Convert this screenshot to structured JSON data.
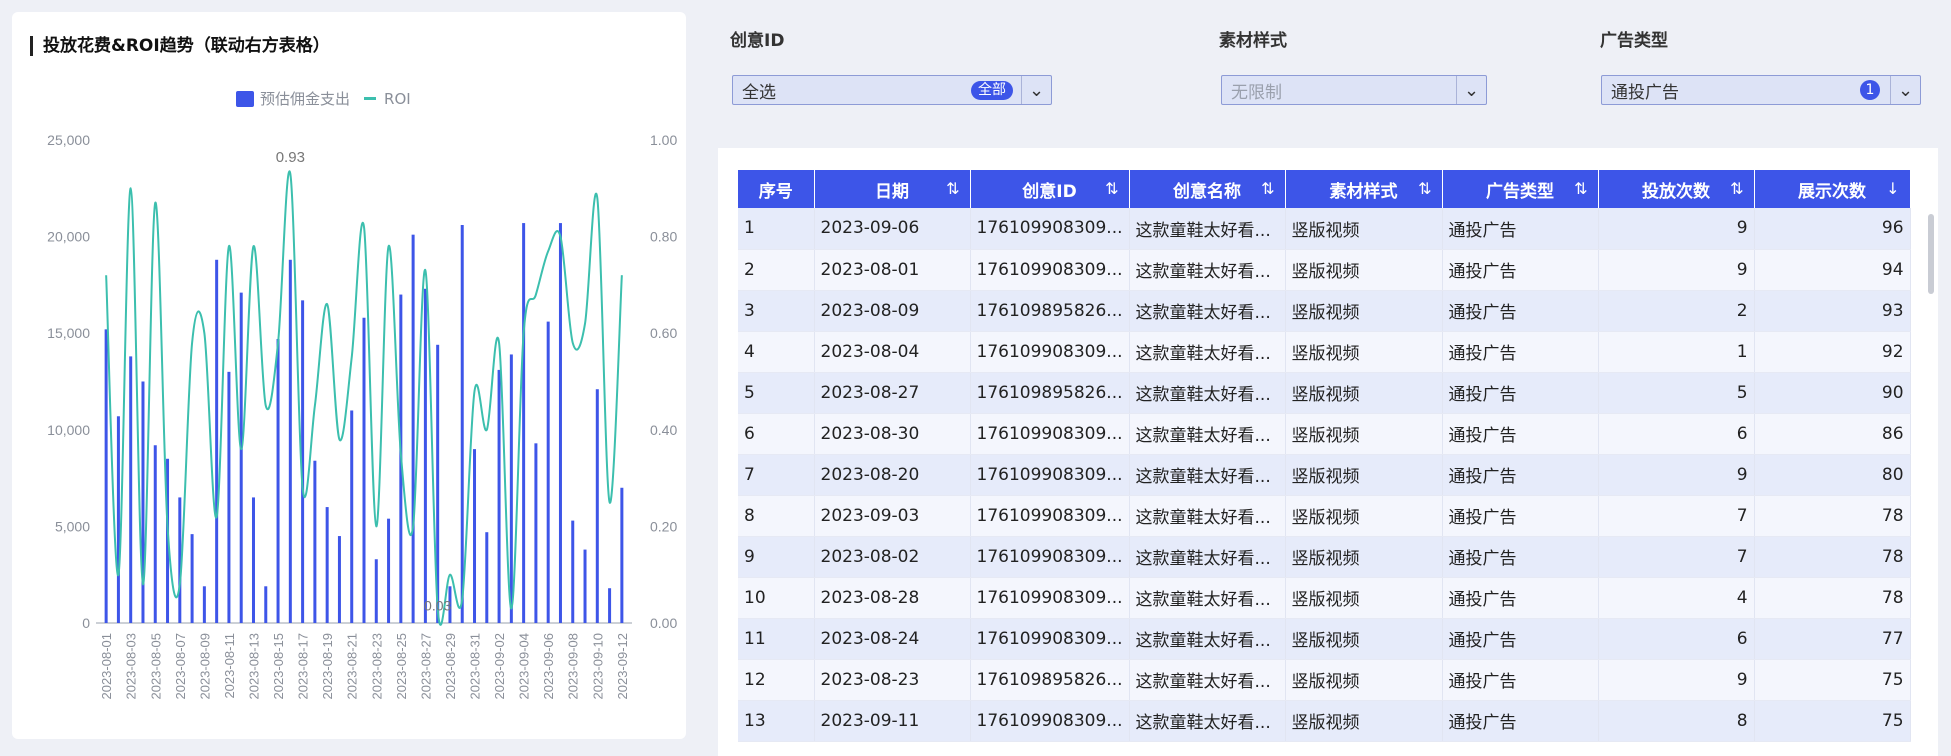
{
  "chart": {
    "title": "投放花费&ROI趋势（联动右方表格）",
    "legend": [
      {
        "name": "预估佣金支出",
        "kind": "bar",
        "color": "#3d55e8"
      },
      {
        "name": "ROI",
        "kind": "line",
        "color": "#3cbfae"
      }
    ],
    "annotations": {
      "max_label": "0.93",
      "min_label": "0.03"
    }
  },
  "chart_data": {
    "type": "bar",
    "x": [
      "2023-08-01",
      "2023-08-02",
      "2023-08-03",
      "2023-08-04",
      "2023-08-05",
      "2023-08-06",
      "2023-08-07",
      "2023-08-08",
      "2023-08-09",
      "2023-08-10",
      "2023-08-11",
      "2023-08-12",
      "2023-08-13",
      "2023-08-14",
      "2023-08-15",
      "2023-08-16",
      "2023-08-17",
      "2023-08-18",
      "2023-08-19",
      "2023-08-20",
      "2023-08-21",
      "2023-08-22",
      "2023-08-23",
      "2023-08-24",
      "2023-08-25",
      "2023-08-26",
      "2023-08-27",
      "2023-08-28",
      "2023-08-29",
      "2023-08-30",
      "2023-08-31",
      "2023-09-01",
      "2023-09-02",
      "2023-09-03",
      "2023-09-04",
      "2023-09-05",
      "2023-09-06",
      "2023-09-07",
      "2023-09-08",
      "2023-09-09",
      "2023-09-10",
      "2023-09-11",
      "2023-09-12"
    ],
    "xticks": [
      "2023-08-01",
      "2023-08-03",
      "2023-08-05",
      "2023-08-07",
      "2023-08-09",
      "2023-08-11",
      "2023-08-13",
      "2023-08-15",
      "2023-08-17",
      "2023-08-19",
      "2023-08-21",
      "2023-08-23",
      "2023-08-25",
      "2023-08-27",
      "2023-08-29",
      "2023-08-31",
      "2023-09-02",
      "2023-09-04",
      "2023-09-06",
      "2023-09-08",
      "2023-09-10",
      "2023-09-12"
    ],
    "series": [
      {
        "name": "预估佣金支出",
        "axis": "left",
        "type": "bar",
        "values": [
          15200,
          10700,
          13800,
          12500,
          9200,
          8500,
          6500,
          4600,
          1900,
          18800,
          13000,
          17100,
          6500,
          1900,
          14700,
          18800,
          16700,
          8400,
          6000,
          4500,
          11000,
          15800,
          3300,
          5400,
          17000,
          20100,
          17300,
          14400,
          1900,
          20600,
          9000,
          4700,
          13100,
          13900,
          20700,
          9300,
          15600,
          20700,
          5300,
          3800,
          12100,
          1800,
          7000
        ]
      },
      {
        "name": "ROI",
        "axis": "right",
        "type": "line",
        "values": [
          0.72,
          0.1,
          0.9,
          0.08,
          0.87,
          0.2,
          0.08,
          0.58,
          0.6,
          0.22,
          0.78,
          0.36,
          0.78,
          0.45,
          0.58,
          0.93,
          0.28,
          0.45,
          0.66,
          0.38,
          0.55,
          0.82,
          0.2,
          0.78,
          0.35,
          0.2,
          0.73,
          0.03,
          0.1,
          0.05,
          0.48,
          0.4,
          0.58,
          0.03,
          0.6,
          0.68,
          0.77,
          0.8,
          0.58,
          0.62,
          0.88,
          0.25,
          0.72
        ]
      }
    ],
    "ylim_left": [
      0,
      25000
    ],
    "yticks_left": [
      "0",
      "5,000",
      "10,000",
      "15,000",
      "20,000",
      "25,000"
    ],
    "ylim_right": [
      0,
      1
    ],
    "yticks_right": [
      "0.00",
      "0.20",
      "0.40",
      "0.60",
      "0.80",
      "1.00"
    ],
    "legend_position": "top-center",
    "grid": false
  },
  "filters": [
    {
      "label": "创意ID",
      "value": "全选",
      "badge": "全部",
      "disabled": false
    },
    {
      "label": "素材样式",
      "value": "无限制",
      "badge": "",
      "disabled": true
    },
    {
      "label": "广告类型",
      "value": "通投广告",
      "badge": "1",
      "disabled": false
    }
  ],
  "table": {
    "columns": [
      "序号",
      "日期",
      "创意ID",
      "创意名称",
      "素材样式",
      "广告类型",
      "投放次数",
      "展示次数"
    ],
    "sort_icons": [
      "",
      "⇅",
      "⇅",
      "⇅",
      "⇅",
      "⇅",
      "⇅",
      "↓"
    ],
    "rows": [
      [
        "1",
        "2023-09-06",
        "176109908309...",
        "这款童鞋太好看...",
        "竖版视频",
        "通投广告",
        "9",
        "96"
      ],
      [
        "2",
        "2023-08-01",
        "176109908309...",
        "这款童鞋太好看...",
        "竖版视频",
        "通投广告",
        "9",
        "94"
      ],
      [
        "3",
        "2023-08-09",
        "176109895826...",
        "这款童鞋太好看...",
        "竖版视频",
        "通投广告",
        "2",
        "93"
      ],
      [
        "4",
        "2023-08-04",
        "176109908309...",
        "这款童鞋太好看...",
        "竖版视频",
        "通投广告",
        "1",
        "92"
      ],
      [
        "5",
        "2023-08-27",
        "176109895826...",
        "这款童鞋太好看...",
        "竖版视频",
        "通投广告",
        "5",
        "90"
      ],
      [
        "6",
        "2023-08-30",
        "176109908309...",
        "这款童鞋太好看...",
        "竖版视频",
        "通投广告",
        "6",
        "86"
      ],
      [
        "7",
        "2023-08-20",
        "176109908309...",
        "这款童鞋太好看...",
        "竖版视频",
        "通投广告",
        "9",
        "80"
      ],
      [
        "8",
        "2023-09-03",
        "176109908309...",
        "这款童鞋太好看...",
        "竖版视频",
        "通投广告",
        "7",
        "78"
      ],
      [
        "9",
        "2023-08-02",
        "176109908309...",
        "这款童鞋太好看...",
        "竖版视频",
        "通投广告",
        "7",
        "78"
      ],
      [
        "10",
        "2023-08-28",
        "176109908309...",
        "这款童鞋太好看...",
        "竖版视频",
        "通投广告",
        "4",
        "78"
      ],
      [
        "11",
        "2023-08-24",
        "176109908309...",
        "这款童鞋太好看...",
        "竖版视频",
        "通投广告",
        "6",
        "77"
      ],
      [
        "12",
        "2023-08-23",
        "176109895826...",
        "这款童鞋太好看...",
        "竖版视频",
        "通投广告",
        "9",
        "75"
      ],
      [
        "13",
        "2023-09-11",
        "176109908309...",
        "这款童鞋太好看...",
        "竖版视频",
        "通投广告",
        "8",
        "75"
      ]
    ]
  }
}
